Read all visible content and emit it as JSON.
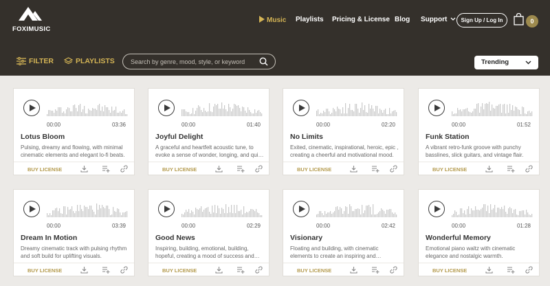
{
  "brand": {
    "name": "FOXIMUSIC",
    "accent": "#d4b455",
    "header_bg": "#34302b"
  },
  "nav": {
    "items": [
      {
        "label": "Music",
        "active": true
      },
      {
        "label": "Playlists"
      },
      {
        "label": "Pricing & License"
      },
      {
        "label": "Blog"
      },
      {
        "label": "Support"
      }
    ],
    "signup": "Sign Up / Log In",
    "cart_count": "0"
  },
  "toolbar": {
    "filter": "FILTER",
    "playlists": "PLAYLISTS",
    "search_placeholder": "Search by genre, mood, style, or keyword",
    "sort": "Trending"
  },
  "tracks": [
    {
      "title": "Lotus Bloom",
      "start": "00:00",
      "duration": "03:36",
      "desc": "Pulsing, dreamy and flowing, with minimal cinematic elements and elegant lo-fi beats.",
      "buy": "BUY LICENSE"
    },
    {
      "title": "Joyful Delight",
      "start": "00:00",
      "duration": "01:40",
      "desc": "A graceful and heartfelt acoustic tune, to evoke a sense of wonder, longing, and qui…",
      "buy": "BUY LICENSE"
    },
    {
      "title": "No Limits",
      "start": "00:00",
      "duration": "02:20",
      "desc": "Exited, cinematic, inspirational, heroic, epic , creating a cheerful and motivational mood.",
      "buy": "BUY LICENSE"
    },
    {
      "title": "Funk Station",
      "start": "00:00",
      "duration": "01:52",
      "desc": "A vibrant retro-funk groove with punchy basslines, slick guitars, and vintage flair.",
      "buy": "BUY LICENSE"
    },
    {
      "title": "Dream In Motion",
      "start": "00:00",
      "duration": "03:39",
      "desc": "Dreamy cinematic track with pulsing rhythm and soft build for uplifting visuals.",
      "buy": "BUY LICENSE"
    },
    {
      "title": "Good News",
      "start": "00:00",
      "duration": "02:29",
      "desc": "Inspiring, building, emotional, building, hopeful, creating a mood of success and…",
      "buy": "BUY LICENSE"
    },
    {
      "title": "Visionary",
      "start": "00:00",
      "duration": "02:42",
      "desc": "Floating and building, with cinematic elements to create an inspiring and…",
      "buy": "BUY LICENSE"
    },
    {
      "title": "Wonderful Memory",
      "start": "00:00",
      "duration": "01:28",
      "desc": "Emotional piano waltz with cinematic elegance and nostalgic warmth.",
      "buy": "BUY LICENSE"
    }
  ]
}
